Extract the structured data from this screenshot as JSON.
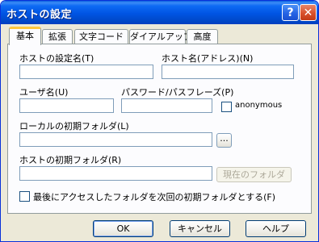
{
  "window": {
    "title": "ホストの設定",
    "help_button": "?",
    "close_button": "✕"
  },
  "tabs": [
    {
      "label": "基本",
      "active": true
    },
    {
      "label": "拡張",
      "active": false
    },
    {
      "label": "文字コード",
      "active": false
    },
    {
      "label": "ダイアルアップ",
      "active": false
    },
    {
      "label": "高度",
      "active": false
    }
  ],
  "form": {
    "host_setting_name": {
      "label": "ホストの設定名(T)",
      "value": ""
    },
    "host_name": {
      "label": "ホスト名(アドレス)(N)",
      "value": ""
    },
    "username": {
      "label": "ユーザ名(U)",
      "value": ""
    },
    "password": {
      "label": "パスワード/パスフレーズ(P)",
      "value": ""
    },
    "anonymous": {
      "label": "anonymous",
      "checked": false
    },
    "local_initial_folder": {
      "label": "ローカルの初期フォルダ(L)",
      "value": "",
      "browse_label": "..."
    },
    "host_initial_folder": {
      "label": "ホストの初期フォルダ(R)",
      "value": "",
      "current_folder_label": "現在のフォルダ"
    },
    "last_accessed_folder": {
      "label": "最後にアクセスしたフォルダを次回の初期フォルダとする(F)",
      "checked": false
    }
  },
  "buttons": {
    "ok": "OK",
    "cancel": "キャンセル",
    "help": "ヘルプ"
  },
  "colors": {
    "titlebar": "#0054e3",
    "dialog_bg": "#ece9d8",
    "panel_bg": "#fcfcfe",
    "input_border": "#7f9db9",
    "active_tab_accent": "#ffc83c",
    "close_button": "#d8512c"
  }
}
